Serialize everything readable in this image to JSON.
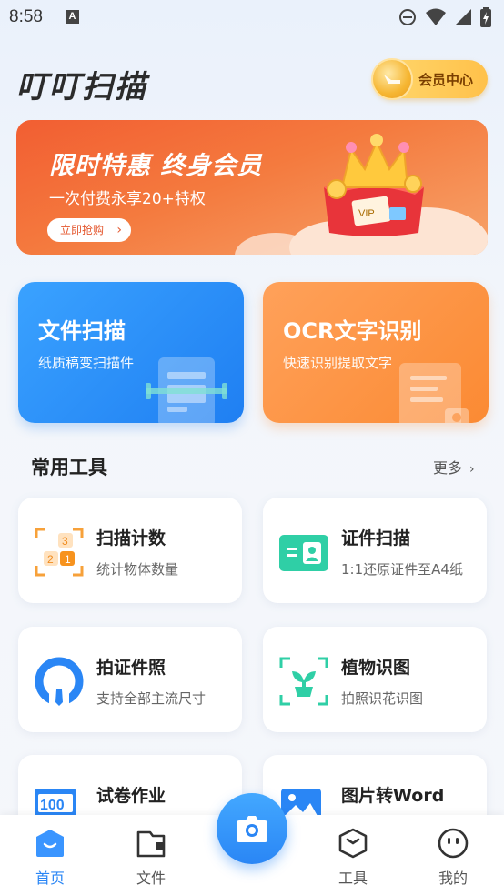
{
  "status_bar": {
    "time": "8:58",
    "app_badge": "A"
  },
  "header": {
    "app_title": "叮叮扫描",
    "vip_center_label": "会员中心"
  },
  "banner": {
    "title": "限时特惠 终身会员",
    "subtitle": "一次付费永享20+特权",
    "button_label": "立即抢购",
    "art_label": "VIP"
  },
  "features": [
    {
      "title": "文件扫描",
      "subtitle": "纸质稿变扫描件"
    },
    {
      "title": "OCR文字识别",
      "subtitle": "快速识别提取文字"
    }
  ],
  "tools_section": {
    "title": "常用工具",
    "more_label": "更多"
  },
  "tools": [
    {
      "name": "扫描计数",
      "desc": "统计物体数量",
      "icon": "count-icon"
    },
    {
      "name": "证件扫描",
      "desc": "1:1还原证件至A4纸",
      "icon": "id-card-icon"
    },
    {
      "name": "拍证件照",
      "desc": "支持全部主流尺寸",
      "icon": "portrait-icon"
    },
    {
      "name": "植物识图",
      "desc": "拍照识花识图",
      "icon": "plant-icon"
    },
    {
      "name": "试卷作业",
      "desc": "",
      "icon": "exam-100-icon"
    },
    {
      "name": "图片转Word",
      "desc": "",
      "icon": "image-icon"
    }
  ],
  "count_icon_digits": [
    "3",
    "2",
    "1"
  ],
  "exam_icon_text": "100",
  "bottom_nav": [
    {
      "label": "首页",
      "icon": "home-icon",
      "active": true
    },
    {
      "label": "文件",
      "icon": "folder-icon",
      "active": false
    },
    {
      "label": "工具",
      "icon": "tools-icon",
      "active": false
    },
    {
      "label": "我的",
      "icon": "profile-icon",
      "active": false
    }
  ],
  "colors": {
    "primary_blue": "#2a86f5",
    "ocr_orange": "#fb8a33",
    "banner_red": "#f25e32",
    "teal": "#2fcfa6"
  }
}
